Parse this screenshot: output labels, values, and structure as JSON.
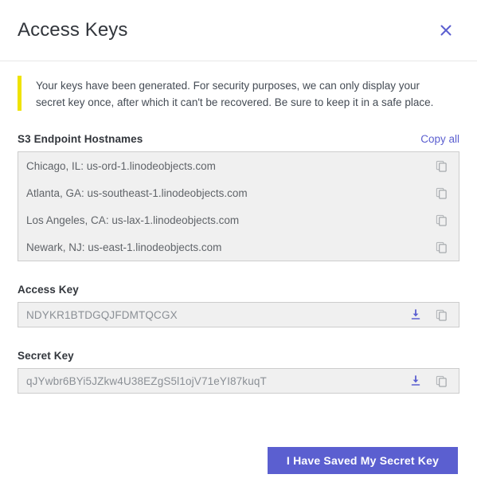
{
  "dialog": {
    "title": "Access Keys",
    "close_icon": "close-icon"
  },
  "notice": {
    "text": "Your keys have been generated. For security purposes, we can only display your secret key once, after which it can't be recovered. Be sure to keep it in a safe place.",
    "bar_color": "#efe300"
  },
  "endpoints_section": {
    "label": "S3 Endpoint Hostnames",
    "copy_all_label": "Copy all",
    "rows": [
      {
        "text": "Chicago, IL: us-ord-1.linodeobjects.com",
        "copy_icon": "copy-icon"
      },
      {
        "text": "Atlanta, GA: us-southeast-1.linodeobjects.com",
        "copy_icon": "copy-icon"
      },
      {
        "text": "Los Angeles, CA: us-lax-1.linodeobjects.com",
        "copy_icon": "copy-icon"
      },
      {
        "text": "Newark, NJ: us-east-1.linodeobjects.com",
        "copy_icon": "copy-icon"
      }
    ]
  },
  "access_key": {
    "label": "Access Key",
    "value": "NDYKR1BTDGQJFDMTQCGX",
    "download_icon": "download-icon",
    "copy_icon": "copy-icon"
  },
  "secret_key": {
    "label": "Secret Key",
    "value": "qJYwbr6BYi5JZkw4U38EZgS5l1ojV71eYI87kuqT",
    "download_icon": "download-icon",
    "copy_icon": "copy-icon"
  },
  "footer": {
    "confirm_label": "I Have Saved My Secret Key"
  },
  "colors": {
    "accent": "#5b5fd0",
    "notice_bar": "#efe300",
    "field_bg": "#f0f0f0",
    "field_border": "#cccccc",
    "text": "#32363c",
    "muted_text": "#8a8f95"
  }
}
